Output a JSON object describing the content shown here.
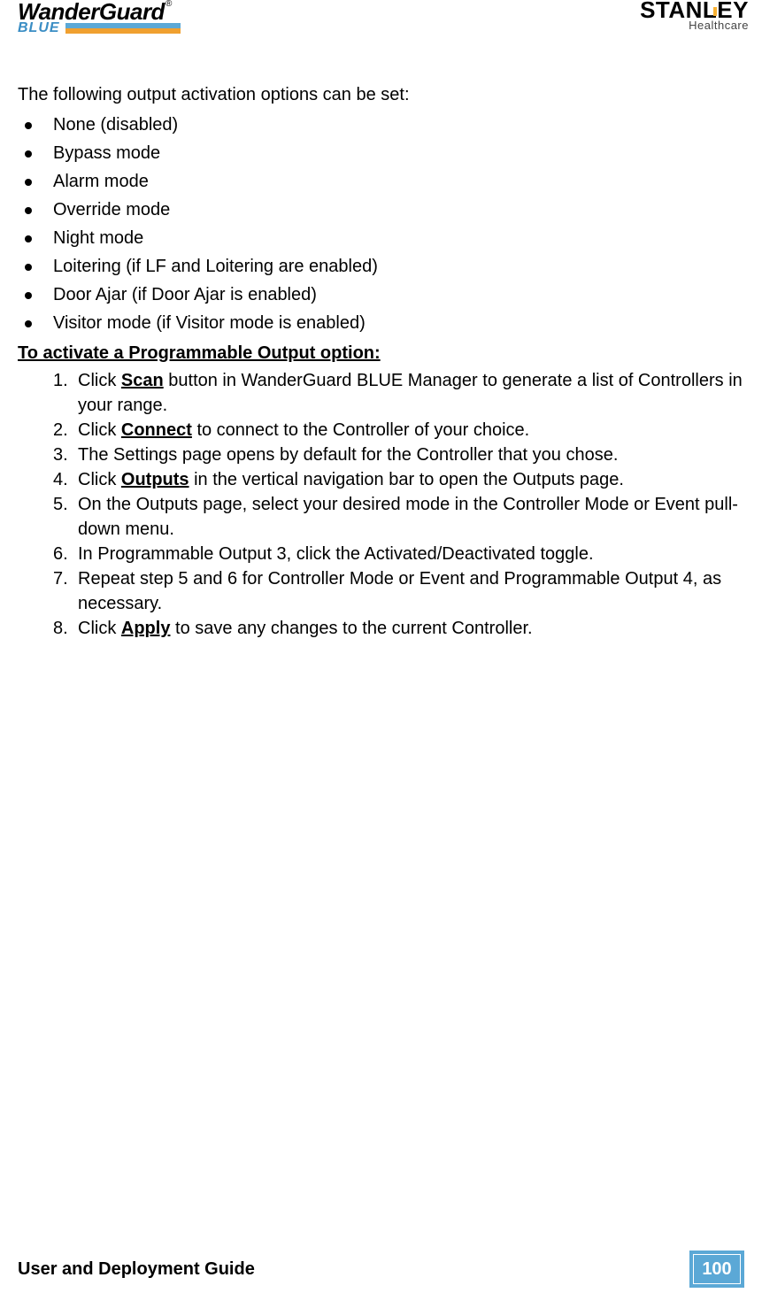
{
  "header": {
    "logo_left_main": "WanderGuard",
    "logo_left_reg": "®",
    "logo_left_sub": "BLUE",
    "logo_right_main": "STANLEY",
    "logo_right_sub": "Healthcare"
  },
  "content": {
    "intro": "The following output activation options can be set:",
    "bullets": [
      "None (disabled)",
      "Bypass mode",
      "Alarm mode",
      "Override mode",
      "Night mode",
      "Loitering (if LF and Loitering are enabled)",
      "Door Ajar (if Door Ajar is enabled)",
      "Visitor mode (if Visitor mode is enabled)"
    ],
    "section_heading": "To activate a Programmable Output option:",
    "steps": [
      {
        "pre": "Click ",
        "bold": "Scan",
        "post": " button in WanderGuard BLUE Manager to generate a list of Controllers in your range."
      },
      {
        "pre": "Click ",
        "bold": "Connect",
        "post": " to connect to the Controller of your choice."
      },
      {
        "pre": "",
        "bold": "",
        "post": "The Settings page opens by default for the Controller that you chose."
      },
      {
        "pre": "Click ",
        "bold": "Outputs",
        "post": " in the vertical navigation bar to open the Outputs page."
      },
      {
        "pre": "",
        "bold": "",
        "post": "On the Outputs page, select your desired mode in the Controller Mode or Event pull-down menu."
      },
      {
        "pre": "",
        "bold": "",
        "post": "In Programmable Output 3, click the Activated/Deactivated toggle."
      },
      {
        "pre": "",
        "bold": "",
        "post": "Repeat step 5 and 6 for Controller Mode or Event and Programmable Output 4, as necessary."
      },
      {
        "pre": "Click ",
        "bold": "Apply",
        "post": " to save any changes to the current Controller."
      }
    ]
  },
  "footer": {
    "title": "User and Deployment Guide",
    "page": "100"
  }
}
